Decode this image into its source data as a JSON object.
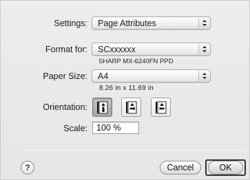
{
  "settings": {
    "label": "Settings:",
    "value": "Page Attributes"
  },
  "format_for": {
    "label": "Format for:",
    "value": "SCxxxxxx",
    "printer_name": "SHARP MX-6240FN PPD"
  },
  "paper_size": {
    "label": "Paper Size:",
    "value": "A4",
    "dimensions": "8.26 in x 11.69 in"
  },
  "orientation": {
    "label": "Orientation:",
    "options": [
      "portrait",
      "landscape",
      "landscape-reversed"
    ],
    "selected": "portrait"
  },
  "scale": {
    "label": "Scale:",
    "value": "100 %"
  },
  "buttons": {
    "help": "?",
    "cancel": "Cancel",
    "ok": "OK"
  }
}
